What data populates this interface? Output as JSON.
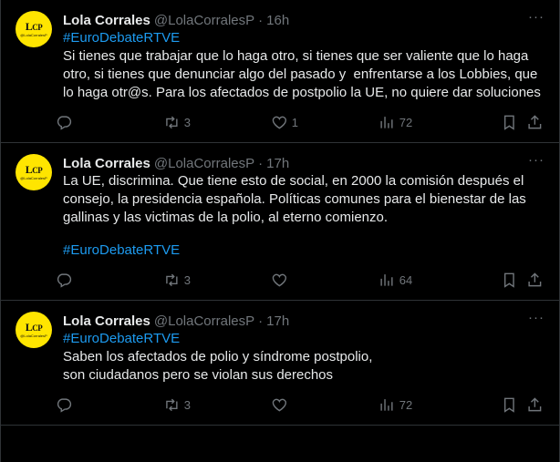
{
  "colors": {
    "accent": "#1d9bf0",
    "secondary": "#71767b",
    "primary_text": "#e7e9ea",
    "avatar_bg": "#ffe500"
  },
  "tweets": [
    {
      "name": "Lola Corrales",
      "handle": "@LolaCorralesP",
      "dot": "·",
      "time": "16h",
      "hashtag_top": "#EuroDebateRTVE",
      "text": "Si tienes que trabajar que lo haga otro, si tienes que ser valiente que lo haga otro, si tienes que denunciar algo del pasado y  enfrentarse a los Lobbies, que lo haga otr@s. Para los afectados de postpolio la UE, no quiere dar soluciones",
      "hashtag_bottom": "",
      "replies": "",
      "retweets": "3",
      "likes": "1",
      "views": "72"
    },
    {
      "name": "Lola Corrales",
      "handle": "@LolaCorralesP",
      "dot": "·",
      "time": "17h",
      "hashtag_top": "",
      "text": "La UE, discrimina. Que tiene esto de social, en 2000 la comisión después el consejo, la presidencia española. Políticas comunes para el bienestar de las gallinas y las victimas de la polio, al eterno comienzo.",
      "hashtag_bottom": " #EuroDebateRTVE",
      "replies": "",
      "retweets": "3",
      "likes": "",
      "views": "64"
    },
    {
      "name": "Lola Corrales",
      "handle": "@LolaCorralesP",
      "dot": "·",
      "time": "17h",
      "hashtag_top": "#EuroDebateRTVE",
      "text": "Saben los afectados de polio y síndrome postpolio,\nson ciudadanos pero se violan sus derechos",
      "hashtag_bottom": "",
      "replies": "",
      "retweets": "3",
      "likes": "",
      "views": "72"
    }
  ],
  "avatar": {
    "logo_text": "LCP",
    "logo_sub": "@LolaCorralesP"
  },
  "icons": {
    "reply": "reply-icon",
    "retweet": "retweet-icon",
    "like": "heart-icon",
    "views": "views-icon",
    "bookmark": "bookmark-icon",
    "share": "share-icon",
    "more": "more-icon"
  }
}
